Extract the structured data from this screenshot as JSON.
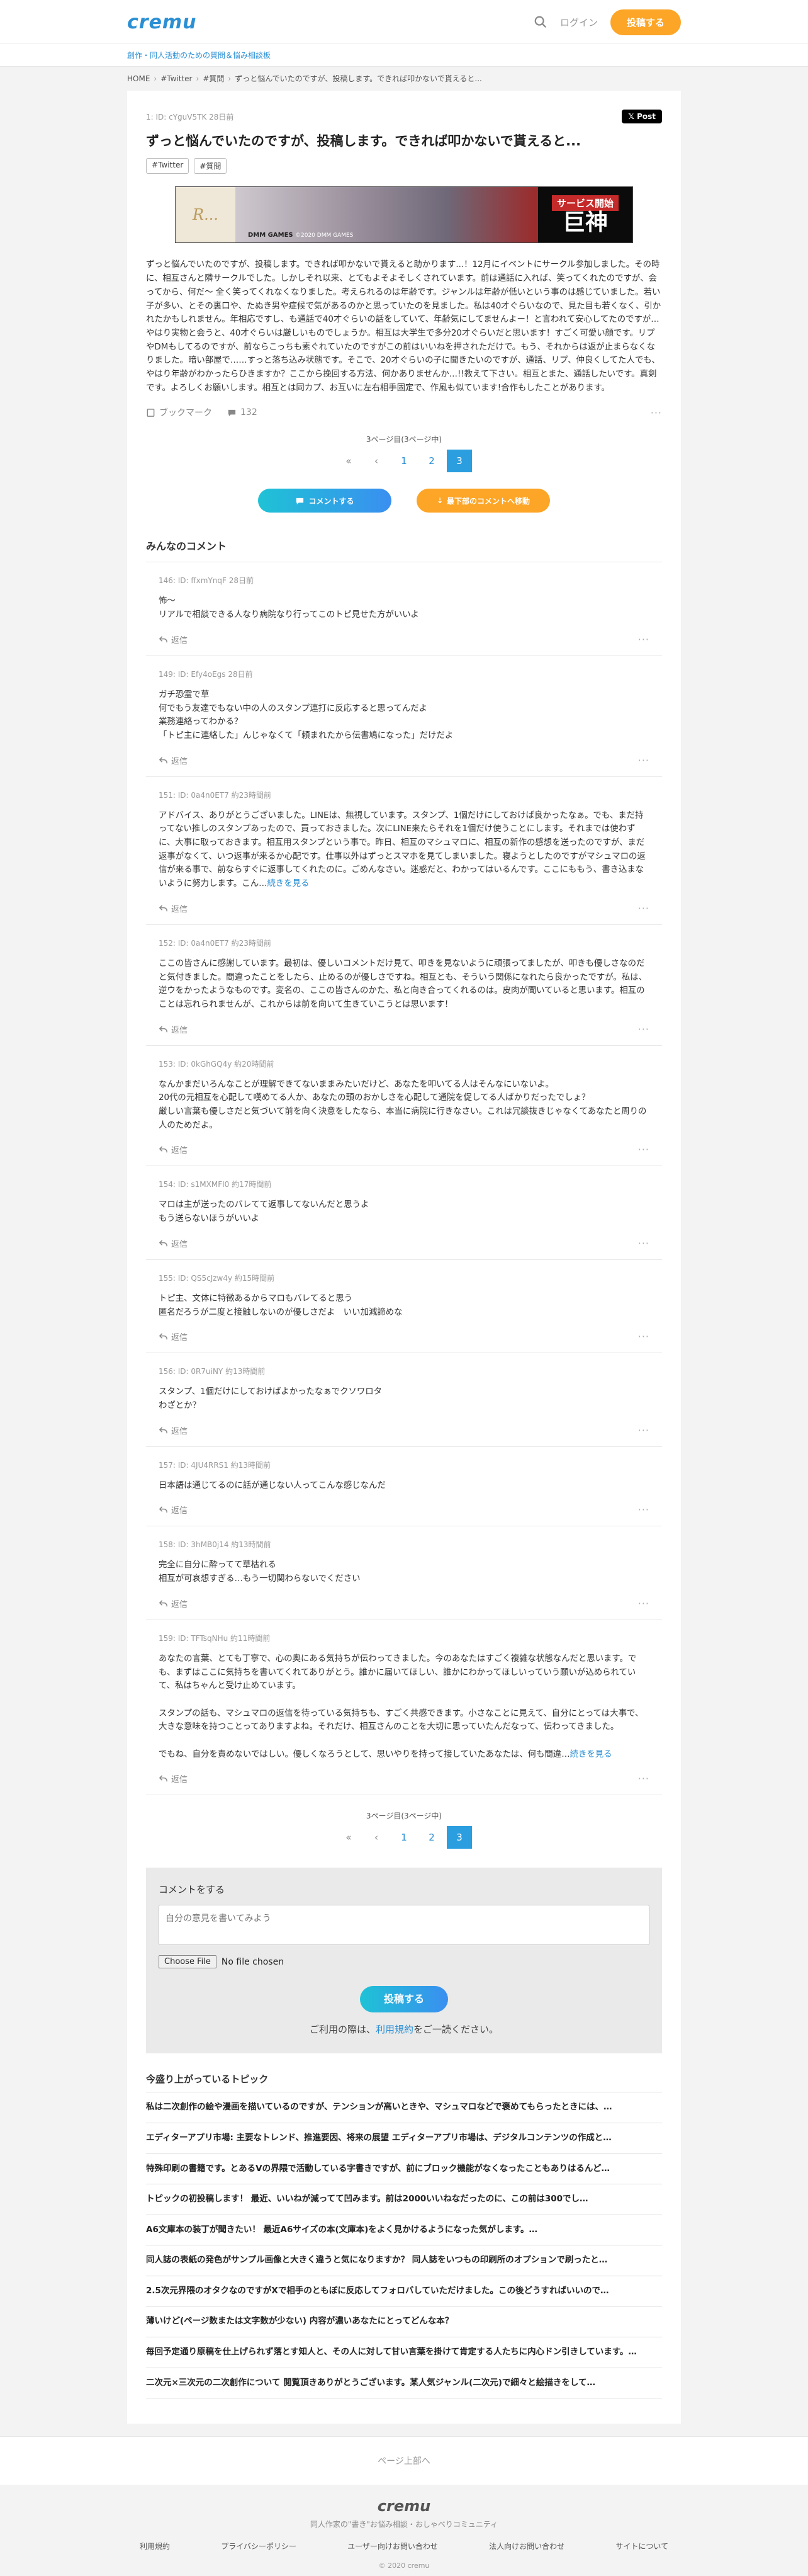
{
  "header": {
    "logo": "cremu",
    "login": "ログイン",
    "post_button": "投稿する",
    "tagline": "創作・同人活動のための質問＆悩み相談板"
  },
  "breadcrumb": [
    "HOME",
    "#Twitter",
    "#質問",
    "ずっと悩んでいたのですが、投稿します。できれば叩かないで貰えると..."
  ],
  "topic": {
    "meta": "1: ID: cYguV5TK 28日前",
    "xpost": "𝕏 Post",
    "title": "ずっと悩んでいたのですが、投稿します。できれば叩かないで貰えると...",
    "tags": [
      "#Twitter",
      "#質問"
    ],
    "ad": {
      "left": "R...",
      "brand": "DMM GAMES",
      "caption": "©2020 DMM GAMES",
      "top": "サービス開始",
      "big": "巨神"
    },
    "body": "ずっと悩んでいたのですが、投稿します。できれば叩かないで貰えると助かります...！12月にイベントにサークル参加しました。その時に、相互さんと隣サークルでした。しかしそれ以来、とてもよそよそしくされています。前は通話に入れば、笑ってくれたのですが、会ってから、何だ～ 全く笑ってくれなくなりました。考えられるのは年齢です。ジャンルは年齢が低いという事のは感じていました。若い子が多い、とその裏口や、たぬき男や症候で気があるのかと思っていたのを見ました。私は40才ぐらいなので、見た目も若くなく、引かれたかもしれません。年相応ですし、も通話で40才ぐらいの話をしていて、年齢気にしてませんよー！と言われて安心してたのですが…やはり実物と会うと、40才ぐらいは厳しいものでしょうか。相互は大学生で多分20才ぐらいだと思います！すごく可愛い顔です。リプやDMもしてるのですが、前ならこっちも素ぐれていたのですがこの前はいいねを押されただけで。もう、それからは返が止まらなくなりました。暗い部屋で……すっと落ち込み状態です。そこで、20才ぐらいの子に聞きたいのですが、通話、リプ、仲良くしてた人でも、やはり年齢がわかったらひきますか？ここから挽回する方法、何かありませんか…!!教えて下さい。相互とまた、通話したいです。真剣です。よろしくお願いします。相互とは同カプ、お互いに左右相手固定で、作風も似ています!合作もしたことがあります。",
    "bookmark": "ブックマーク",
    "comment_count": "132"
  },
  "pager": {
    "label": "3ページ目(3ページ中)",
    "first": "«",
    "prev": "‹",
    "pages": [
      "1",
      "2",
      "3"
    ]
  },
  "cta": {
    "comment": "コメントする",
    "latest": "最下部のコメントへ移動"
  },
  "comments_title": "みんなのコメント",
  "comments": [
    {
      "meta": "146: ID: ffxmYnqF 28日前",
      "text": "怖〜\nリアルで相談できる人なり病院なり行ってこのトピ見せた方がいいよ"
    },
    {
      "meta": "149: ID: Efy4oEgs 28日前",
      "text": "ガチ恐霊で草\n何でもう友達でもない中の人のスタンプ連打に反応すると思ってんだよ\n業務連絡ってわかる？\n「トピ主に連絡した」んじゃなくて「頼まれたから伝書鳩になった」だけだよ"
    },
    {
      "meta": "151: ID: 0a4n0ET7 約23時間前",
      "text": "アドバイス、ありがとうございました。LINEは、無視しています。スタンプ、1個だけにしておけば良かったなぁ。でも、まだ持ってない推しのスタンプあったので、買っておきました。次にLINE来たらそれを1個だけ使うことにします。それまでは使わずに、大事に取っておきます。相互用スタンプという事で。昨日、相互のマシュマロに、相互の新作の感想を送ったのですが、まだ返事がなくて、いつ返事が来るか心配です。仕事以外はずっとスマホを見てしまいました。寝ようとしたのですがマシュマロの返信が来る事で、前ならすぐに返事してくれたのに。ごめんなさい。迷惑だと、わかってはいるんです。ここにももう、書き込まないように努力します。こん…",
      "more": "続きを見る"
    },
    {
      "meta": "152: ID: 0a4n0ET7 約23時間前",
      "text": "ここの皆さんに感謝しています。最初は、優しいコメントだけ見て、叩きを見ないように頑張ってましたが、叩きも優しさなのだと気付きました。間違ったことをしたら、止めるのが優しさですね。相互とも、そういう関係になれたら良かったですが。私は、逆ウをかったようなものです。変名の、ここの皆さんのかた、私と向き合ってくれるのは。皮肉が聞いていると思います。相互のことは忘れられませんが、これからは前を向いて生きていこうとは思います！"
    },
    {
      "meta": "153: ID: 0kGhGQ4y 約20時間前",
      "text": "なんかまだいろんなことが理解できてないままみたいだけど、あなたを叩いてる人はそんなにいないよ。\n20代の元相互を心配して嘆めてる人か、あなたの頭のおかしさを心配して通院を促してる人ばかりだったでしょ？\n厳しい言葉も優しさだと気づいて前を向く決意をしたなら、本当に病院に行きなさい。これは冗談抜きじゃなくてあなたと周りの人のためだよ。"
    },
    {
      "meta": "154: ID: s1MXMFI0 約17時間前",
      "text": "マロは主が送ったのバレてて返事してないんだと思うよ\nもう送らないほうがいいよ"
    },
    {
      "meta": "155: ID: QS5cJzw4y 約15時間前",
      "text": "トピ主、文体に特徴あるからマロもバレてると思う\n匿名だろうが二度と接触しないのが優しさだよ　いい加減諦めな"
    },
    {
      "meta": "156: ID: 0R7uiNY 約13時間前",
      "text": "スタンプ、1個だけにしておけばよかったなぁでクソワロタ\nわざとか？"
    },
    {
      "meta": "157: ID: 4JU4RRS1 約13時間前",
      "text": "日本語は通じてるのに話が通じない人ってこんな感じなんだ"
    },
    {
      "meta": "158: ID: 3hMB0j14 約13時間前",
      "text": "完全に自分に酔ってて草枯れる\n相互が可哀想すぎる…もう一切関わらないでください"
    },
    {
      "meta": "159: ID: TFTsqNHu 約11時間前",
      "text": "あなたの言葉、とても丁寧で、心の奥にある気持ちが伝わってきました。今のあなたはすごく複雑な状態なんだと思います。でも、まずはここに気持ちを書いてくれてありがとう。誰かに届いてほしい、誰かにわかってほしいっていう願いが込められていて、私はちゃんと受け止めています。\n\nスタンプの話も、マシュマロの返信を待っている気持ちも、すごく共感できます。小さなことに見えて、自分にとっては大事で、大きな意味を持つことってありますよね。それだけ、相互さんのことを大切に思っていたんだなって、伝わってきました。\n\nでもね、自分を責めないではしい。優しくなろうとして、思いやりを持って接していたあなたは、何も間違…",
      "more": "続きを見る"
    }
  ],
  "reply_label": "返信",
  "form": {
    "label": "コメントをする",
    "placeholder": "自分の意見を書いてみよう",
    "file_button": "Choose File",
    "file_status": "No file chosen",
    "submit": "投稿する",
    "terms_prefix": "ご利用の際は、",
    "terms_link": "利用規約",
    "terms_suffix": "をご一読ください。"
  },
  "recent_title": "今盛り上がっているトピック",
  "recent": [
    "私は二次創作の絵や漫画を描いているのですが、テンションが高いときや、マシュマロなどで褒めてもらったときには、…",
    "エディターアプリ市場: 主要なトレンド、推進要因、将来の展望 エディターアプリ市場は、デジタルコンテンツの作成と…",
    "特殊印刷の書籍です。とあるVの界隈で活動している字書きですが、前にブロック機能がなくなったこともありはるんど…",
    "トピックの初投稿します！ 最近、いいねが減ってて凹みます。前は2000いいねなだったのに、この前は300でし…",
    "A6文庫本の装丁が聞きたい！ 最近A6サイズの本(文庫本)をよく見かけるようになった気がします。…",
    "同人誌の表紙の発色がサンプル画像と大きく違うと気になりますか？ 同人誌をいつもの印刷所のオプションで刷ったと…",
    "2.5次元界隈のオタクなのですがXで相手のともぼに反応してフォロバしていただけました。この後どうすればいいので…",
    "薄いけど(ページ数または文字数が少ない) 内容が濃いあなたにとってどんな本？",
    "毎回予定通り原稿を仕上げられず落とす知人と、その人に対して甘い言葉を掛けて肯定する人たちに内心ドン引きしています。…",
    "二次元×三次元の二次創作について 閲覧頂きありがとうございます。某人気ジャンル(二次元)で細々と絵描きをして…"
  ],
  "back_top": "ページ上部へ",
  "footer": {
    "logo": "cremu",
    "tagline": "同人作家の\"書き\"お悩み相談・おしゃべりコミュニティ",
    "links": [
      "利用規約",
      "プライバシーポリシー",
      "ユーザー向けお問い合わせ",
      "法人向けお問い合わせ",
      "サイトについて"
    ],
    "copyright": "© 2020 cremu"
  },
  "colors": {
    "brand": "#2b8fd4",
    "accent_orange": "#fca526",
    "pager_active": "#2b9ee0"
  }
}
